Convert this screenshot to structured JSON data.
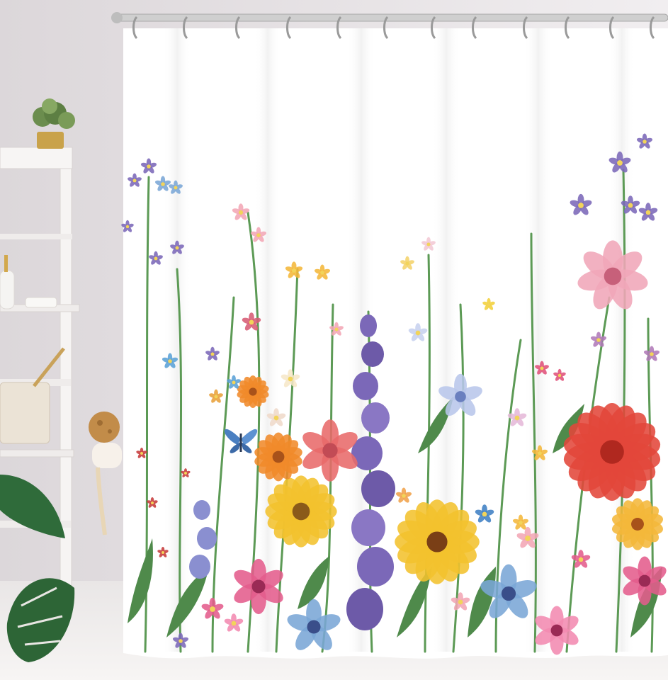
{
  "scene": {
    "subject": "shower-curtain",
    "pattern": "watercolor-wildflowers",
    "colors": {
      "wall": "#ece9ec",
      "curtain": "#ffffff",
      "rod": "#c8c8c8",
      "shelf": "#f3f1f0",
      "leaf": "#2f6b3a",
      "stem": "#5c9a55",
      "red_flower": "#e2473a",
      "yellow_flower": "#f2c12e",
      "orange_flower": "#f08a2a",
      "purple_flower": "#7b68b8",
      "blue_flower": "#7aa6d6",
      "pink_flower": "#e45c8c"
    }
  }
}
